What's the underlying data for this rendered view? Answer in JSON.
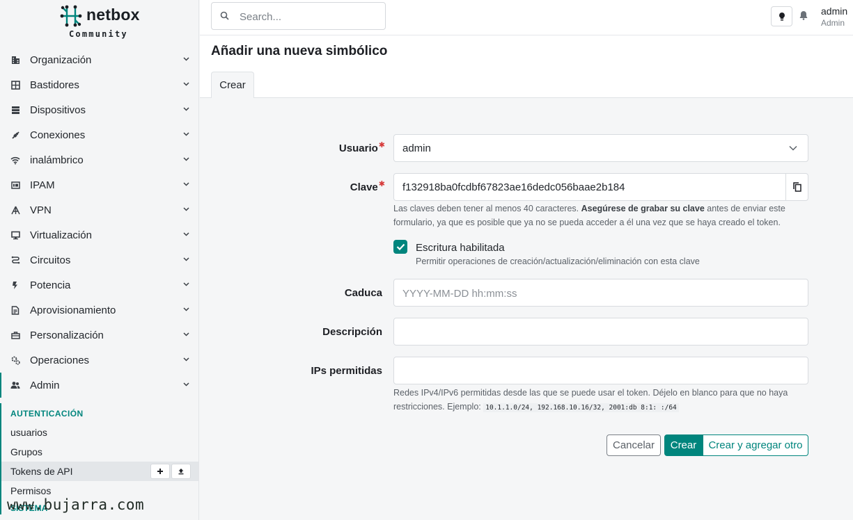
{
  "brand": {
    "name": "netbox",
    "edition": "Community"
  },
  "sidebar": {
    "items": [
      {
        "label": "Organización",
        "icon": "domain-icon"
      },
      {
        "label": "Bastidores",
        "icon": "rack-icon"
      },
      {
        "label": "Dispositivos",
        "icon": "server-icon"
      },
      {
        "label": "Conexiones",
        "icon": "connection-icon"
      },
      {
        "label": "inalámbrico",
        "icon": "wifi-icon"
      },
      {
        "label": "IPAM",
        "icon": "counter-icon"
      },
      {
        "label": "VPN",
        "icon": "tunnel-icon"
      },
      {
        "label": "Virtualización",
        "icon": "monitor-icon"
      },
      {
        "label": "Circuitos",
        "icon": "transit-icon"
      },
      {
        "label": "Potencia",
        "icon": "flash-icon"
      },
      {
        "label": "Aprovisionamiento",
        "icon": "file-document-icon"
      },
      {
        "label": "Personalización",
        "icon": "toolbox-icon"
      },
      {
        "label": "Operaciones",
        "icon": "cogs-icon"
      },
      {
        "label": "Admin",
        "icon": "account-multiple-icon"
      }
    ],
    "admin_section": {
      "heading": "AUTENTICACIÓN",
      "items": [
        "usuarios",
        "Grupos",
        "Tokens de API",
        "Permisos"
      ],
      "selected": "Tokens de API",
      "next_heading": "SISTEMA"
    }
  },
  "header": {
    "search_placeholder": "Search...",
    "user_name": "admin",
    "user_role": "Admin"
  },
  "page": {
    "title": "Añadir una nueva simbólico",
    "tab": "Crear"
  },
  "form": {
    "user": {
      "label": "Usuario",
      "value": "admin"
    },
    "key": {
      "label": "Clave",
      "value": "f132918ba0fcdbf67823ae16dedc056baae2b184",
      "help_1": "Las claves deben tener al menos 40 caracteres. ",
      "help_bold": "Asegúrese de grabar su clave",
      "help_2": " antes de enviar este formulario, ya que es posible que ya no se pueda acceder a él una vez que se haya creado el token."
    },
    "write": {
      "label": "Escritura habilitada",
      "help": "Permitir operaciones de creación/actualización/eliminación con esta clave",
      "checked": true
    },
    "expires": {
      "label": "Caduca",
      "placeholder": "YYYY-MM-DD hh:mm:ss"
    },
    "description": {
      "label": "Descripción",
      "value": ""
    },
    "allowed_ips": {
      "label": "IPs permitidas",
      "value": "",
      "help": "Redes IPv4/IPv6 permitidas desde las que se puede usar el token. Déjelo en blanco para que no haya restricciones. Ejemplo: ",
      "example": "10.1.1.0/24, 192.168.10.16/32, 2001:db 8:1: :/64"
    },
    "buttons": {
      "cancel": "Cancelar",
      "create": "Crear",
      "create_add": "Crear y agregar otro"
    }
  },
  "watermark": "www.bujarra.com",
  "colors": {
    "accent": "#00857d",
    "required": "#d63939"
  }
}
